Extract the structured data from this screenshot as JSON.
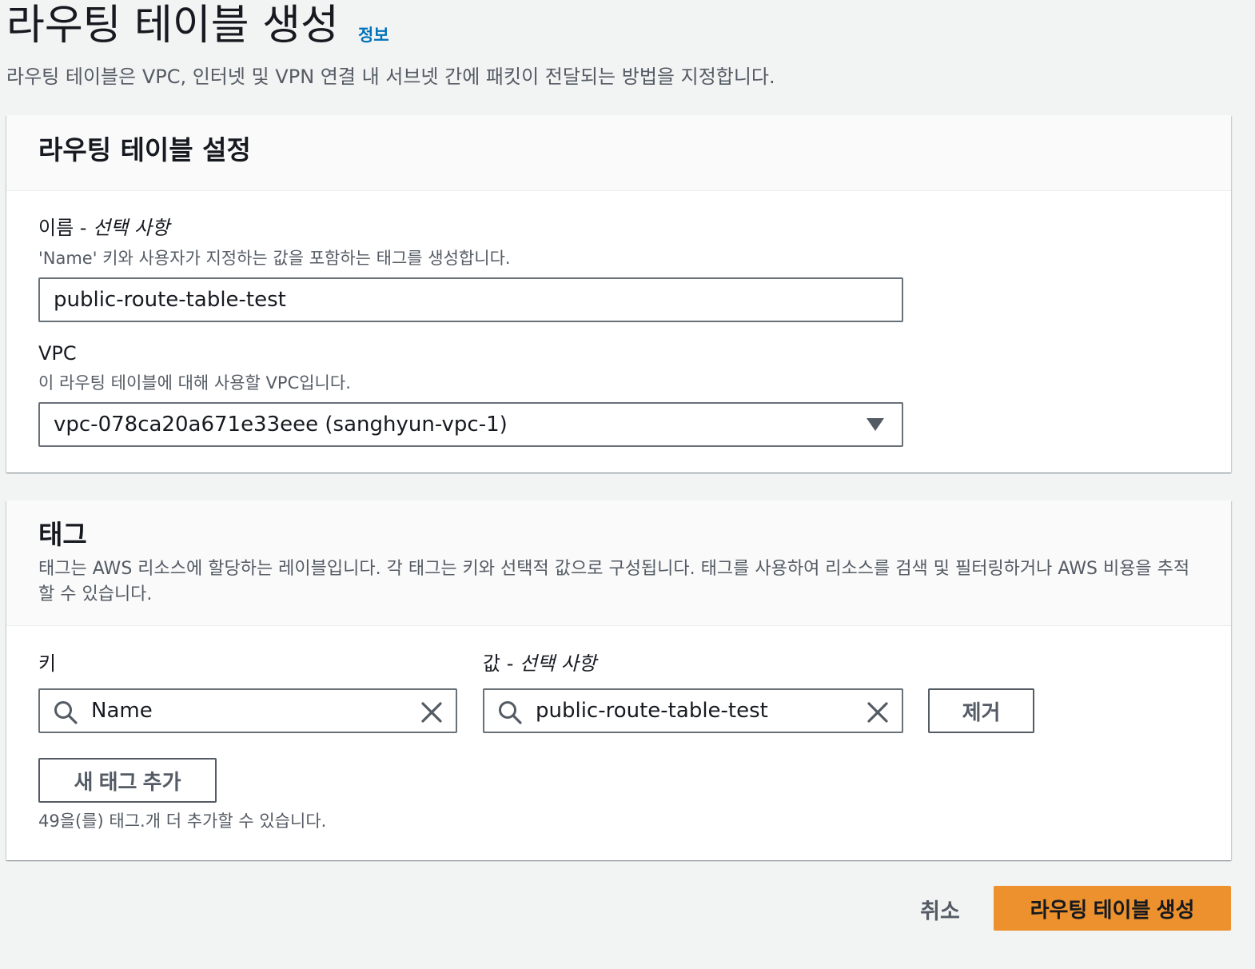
{
  "page": {
    "title": "라우팅 테이블 생성",
    "info_link": "정보",
    "description": "라우팅 테이블은 VPC, 인터넷 및 VPN 연결 내 서브넷 간에 패킷이 전달되는 방법을 지정합니다."
  },
  "settings": {
    "title": "라우팅 테이블 설정",
    "name_label": "이름 - ",
    "name_label_optional": "선택 사항",
    "name_description": "'Name' 키와 사용자가 지정하는 값을 포함하는 태그를 생성합니다.",
    "name_value": "public-route-table-test",
    "vpc_label": "VPC",
    "vpc_description": "이 라우팅 테이블에 대해 사용할 VPC입니다.",
    "vpc_selected": "vpc-078ca20a671e33eee (sanghyun-vpc-1)"
  },
  "tags": {
    "title": "태그",
    "description": "태그는 AWS 리소스에 할당하는 레이블입니다. 각 태그는 키와 선택적 값으로 구성됩니다. 태그를 사용하여 리소스를 검색 및 필터링하거나 AWS 비용을 추적할 수 있습니다.",
    "key_label": "키",
    "value_label": "값 - ",
    "value_label_optional": "선택 사항",
    "rows": [
      {
        "key": "Name",
        "value": "public-route-table-test"
      }
    ],
    "remove_label": "제거",
    "add_label": "새 태그 추가",
    "limit_text": "49을(를) 태그.개 더 추가할 수 있습니다."
  },
  "footer": {
    "cancel_label": "취소",
    "submit_label": "라우팅 테이블 생성"
  },
  "colors": {
    "background": "#f2f3f3",
    "primary_button": "#ec912d",
    "link": "#0073bb",
    "secondary_text": "#545b64"
  }
}
